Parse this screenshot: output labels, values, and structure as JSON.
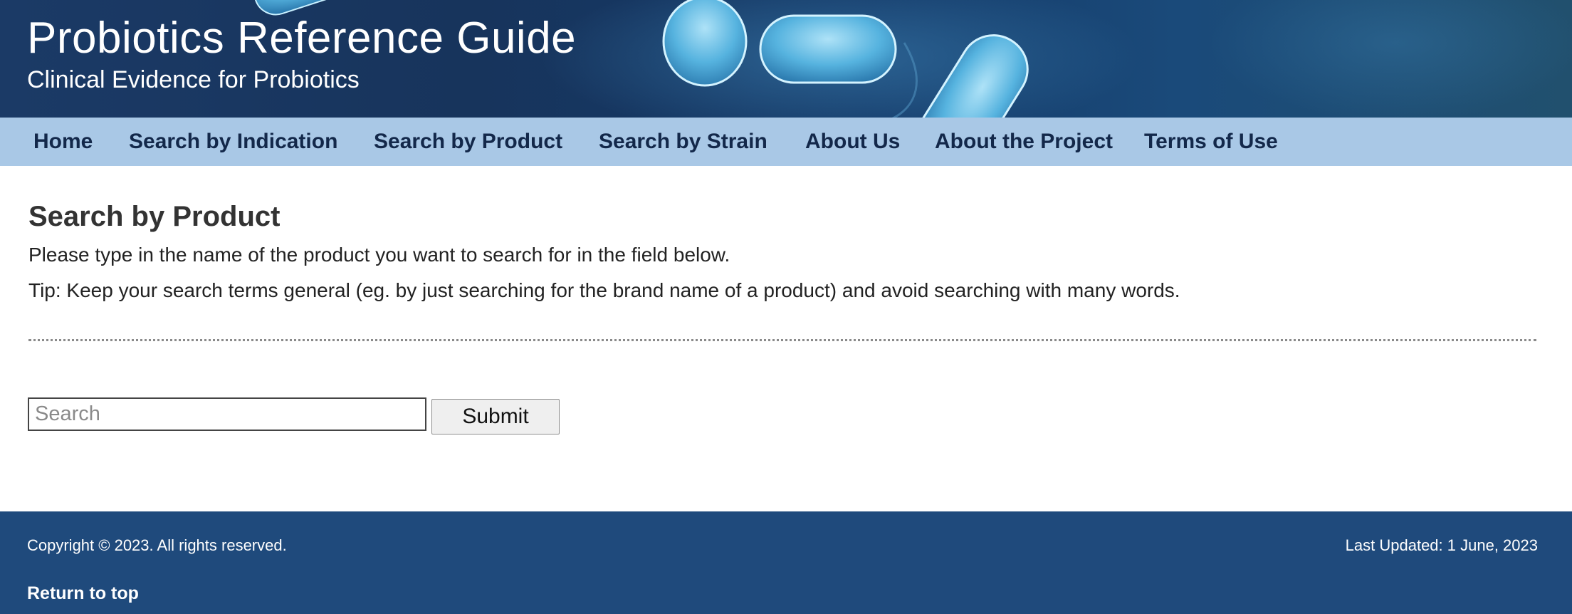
{
  "header": {
    "title": "Probiotics Reference Guide",
    "subtitle": "Clinical Evidence for Probiotics"
  },
  "nav": {
    "items": [
      {
        "label": "Home"
      },
      {
        "label": "Search by Indication"
      },
      {
        "label": "Search by Product"
      },
      {
        "label": "Search by Strain"
      },
      {
        "label": "About Us"
      },
      {
        "label": "About the Project"
      },
      {
        "label": "Terms of Use"
      }
    ]
  },
  "main": {
    "title": "Search by Product",
    "intro": "Please type in the name of the product you want to search for in the field below.",
    "tip": "Tip: Keep your search terms general (eg. by just searching for the brand name of a product) and avoid searching with many words.",
    "search": {
      "placeholder": "Search",
      "value": "",
      "submit_label": "Submit"
    }
  },
  "footer": {
    "copyright": "Copyright © 2023. All rights reserved.",
    "last_updated": "Last Updated: 1 June, 2023",
    "return_to_top": "Return to top"
  },
  "colors": {
    "banner": "#17345c",
    "nav_background": "#a9c8e6",
    "nav_text": "#13284a",
    "footer_background": "#1f4a7c"
  }
}
